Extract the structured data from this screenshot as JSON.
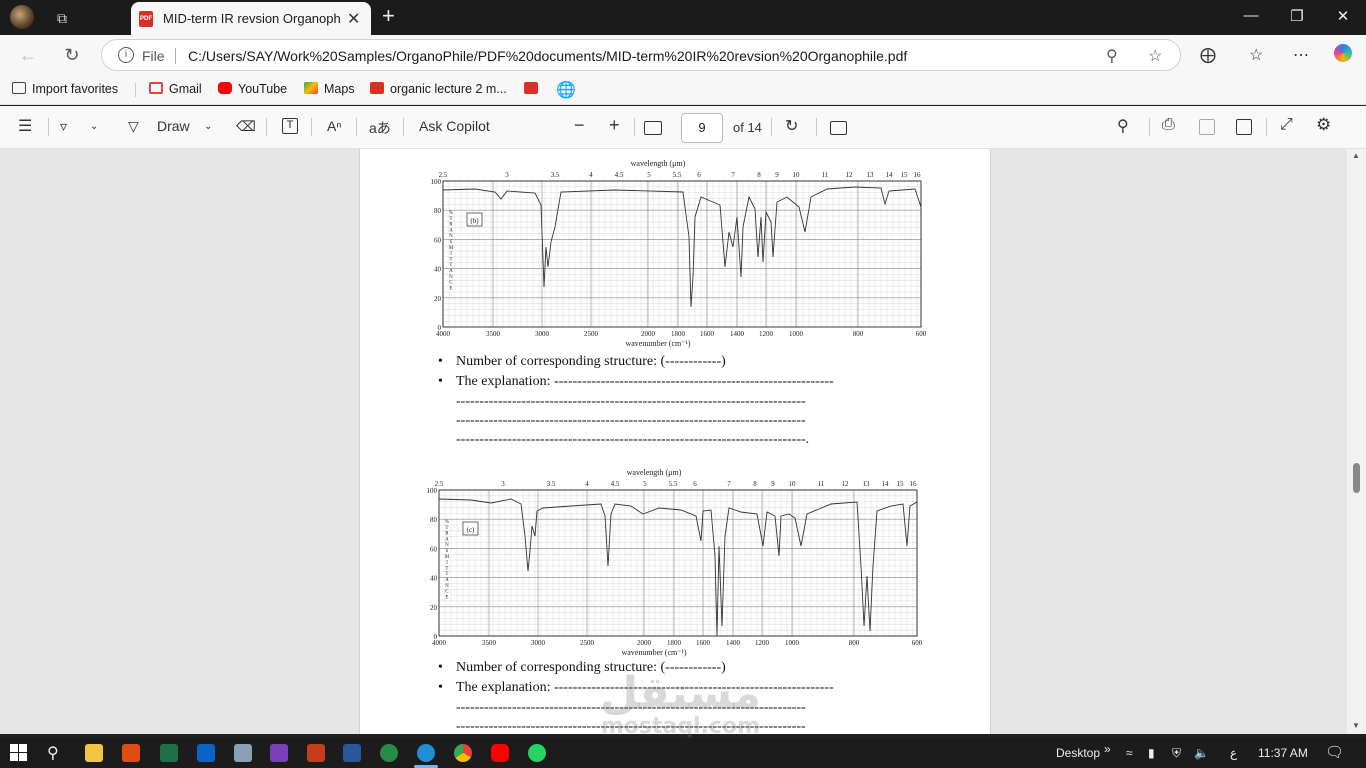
{
  "browser": {
    "tab_title": "MID-term IR revsion Organophile",
    "tab_badge": "PDF",
    "file_label": "File",
    "url": "C:/Users/SAY/Work%20Samples/OrganoPhile/PDF%20documents/MID-term%20IR%20revsion%20Organophile.pdf"
  },
  "favorites": [
    {
      "label": "Import favorites",
      "icon": "import-icon"
    },
    {
      "label": "Gmail",
      "icon": "gmail-icon",
      "color": "#ea4335"
    },
    {
      "label": "YouTube",
      "icon": "youtube-icon",
      "color": "#ff0000"
    },
    {
      "label": "Maps",
      "icon": "maps-icon",
      "color": "#34a853"
    },
    {
      "label": "organic lecture 2 m...",
      "icon": "pdf-icon",
      "color": "#d93025"
    }
  ],
  "pdf_toolbar": {
    "draw_label": "Draw",
    "copilot_label": "Ask Copilot",
    "zoom_out": "−",
    "zoom_in": "+",
    "page_current": "9",
    "page_total": "of 14"
  },
  "spectrum_b": {
    "panel_label": "(b)",
    "top_axis_title": "wavelength (μm)",
    "bottom_axis_title": "wavenumber (cm⁻¹)",
    "side_label": "%TRANSMITTANCE",
    "y_ticks": [
      "100",
      "80",
      "60",
      "40",
      "20",
      "0"
    ],
    "x_ticks": [
      "4000",
      "3500",
      "3000",
      "2500",
      "2000",
      "1800",
      "1600",
      "1400",
      "1200",
      "1000",
      "800",
      "600"
    ],
    "wl_ticks": [
      "2.5",
      "3",
      "3.5",
      "4",
      "4.5",
      "5",
      "5.5",
      "6",
      "7",
      "8",
      "9",
      "10",
      "11",
      "12",
      "13",
      "14",
      "15",
      "16"
    ]
  },
  "spectrum_c": {
    "panel_label": "(c)",
    "top_axis_title": "wavelength (μm)",
    "bottom_axis_title": "wavenumber (cm⁻¹)",
    "side_label": "%TRANSMITTANCE",
    "y_ticks": [
      "100",
      "80",
      "60",
      "40",
      "20",
      "0"
    ],
    "x_ticks": [
      "4000",
      "3500",
      "3000",
      "2500",
      "2000",
      "1800",
      "1600",
      "1400",
      "1200",
      "1000",
      "800",
      "600"
    ],
    "wl_ticks": [
      "2.5",
      "3",
      "3.5",
      "4",
      "4.5",
      "5",
      "5.5",
      "6",
      "7",
      "8",
      "9",
      "10",
      "11",
      "12",
      "13",
      "14",
      "15",
      "16"
    ]
  },
  "questions": {
    "structure": "Number of corresponding structure: (------------)",
    "explanation": "The explanation: ------------------------------------------------------------",
    "dashes": "---------------------------------------------------------------------------",
    "dashes_end": "---------------------------------------------------------------------------."
  },
  "watermark": {
    "arabic": "مستقل",
    "latin": "mostaql.com"
  },
  "taskbar": {
    "desktop_label": "Desktop",
    "lang": "ع",
    "time": "11:37 AM"
  }
}
